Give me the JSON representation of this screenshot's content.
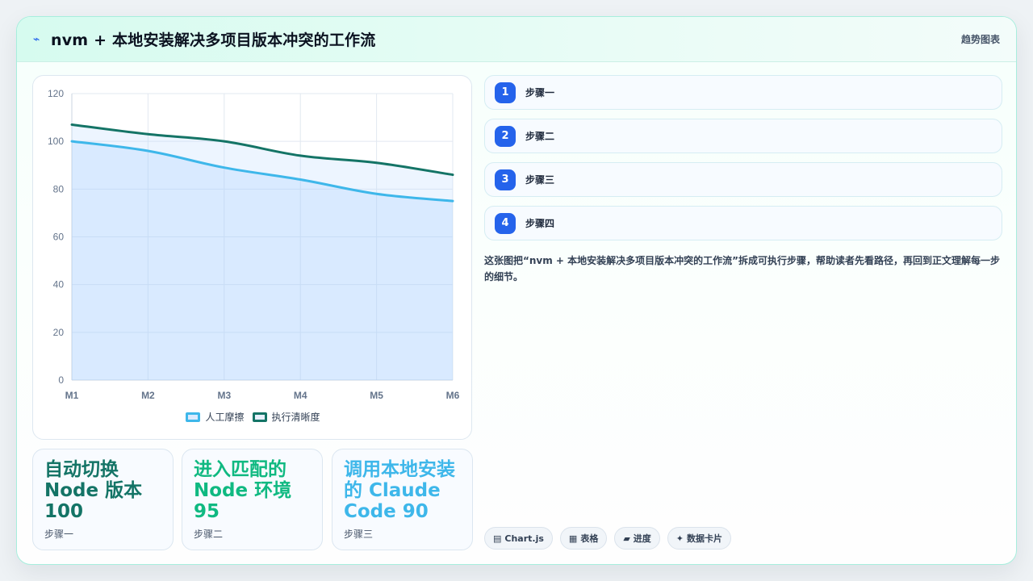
{
  "header": {
    "title_icon": "chart-line-icon",
    "title": "nvm + 本地安装解决多项目版本冲突的工作流",
    "tag": "趋势图表"
  },
  "chart_data": {
    "type": "area",
    "categories": [
      "M1",
      "M2",
      "M3",
      "M4",
      "M5",
      "M6"
    ],
    "ylim": [
      0,
      120
    ],
    "yticks": [
      0,
      20,
      40,
      60,
      80,
      100,
      120
    ],
    "grid": true,
    "legend_position": "bottom",
    "series": [
      {
        "name": "人工摩擦",
        "values": [
          100,
          96,
          89,
          84,
          78,
          75
        ],
        "color": "#3eb7ea",
        "fill": true
      },
      {
        "name": "执行清晰度",
        "values": [
          107,
          103,
          100,
          94,
          91,
          86
        ],
        "color": "#147466",
        "fill": true
      }
    ]
  },
  "stats": [
    {
      "title": "自动切换 Node 版本 100",
      "sub": "步骤一",
      "color": "#147466"
    },
    {
      "title": "进入匹配的 Node 环境 95",
      "sub": "步骤二",
      "color": "#10b981"
    },
    {
      "title": "调用本地安装的 Claude Code 90",
      "sub": "步骤三",
      "color": "#3eb7ea"
    }
  ],
  "steps": [
    {
      "num": "1",
      "label": "步骤一"
    },
    {
      "num": "2",
      "label": "步骤二"
    },
    {
      "num": "3",
      "label": "步骤三"
    },
    {
      "num": "4",
      "label": "步骤四"
    }
  ],
  "description": "这张图把“nvm + 本地安装解决多项目版本冲突的工作流”拆成可执行步骤，帮助读者先看路径，再回到正文理解每一步的细节。",
  "tags": [
    {
      "icon": "▤",
      "label": "Chart.js"
    },
    {
      "icon": "▦",
      "label": "表格"
    },
    {
      "icon": "▰",
      "label": "进度"
    },
    {
      "icon": "✦",
      "label": "数据卡片"
    }
  ]
}
